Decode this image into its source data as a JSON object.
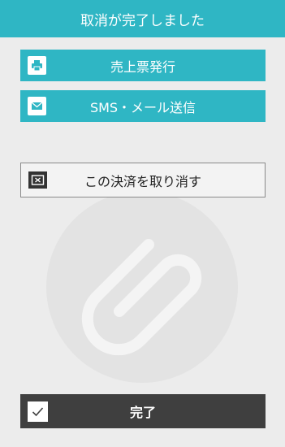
{
  "header": {
    "title": "取消が完了しました"
  },
  "actions": {
    "receipt_label": "売上票発行",
    "receipt_icon": "printer-icon",
    "mail_label": "SMS・メール送信",
    "mail_icon": "envelope-icon",
    "cancel_payment_label": "この決済を取り消す",
    "cancel_payment_icon": "cancel-payment-icon",
    "done_label": "完了",
    "done_icon": "checkmark-icon"
  },
  "colors": {
    "accent": "#2fb6c4",
    "background": "#ececec",
    "dark_button": "#3f3f3f"
  }
}
